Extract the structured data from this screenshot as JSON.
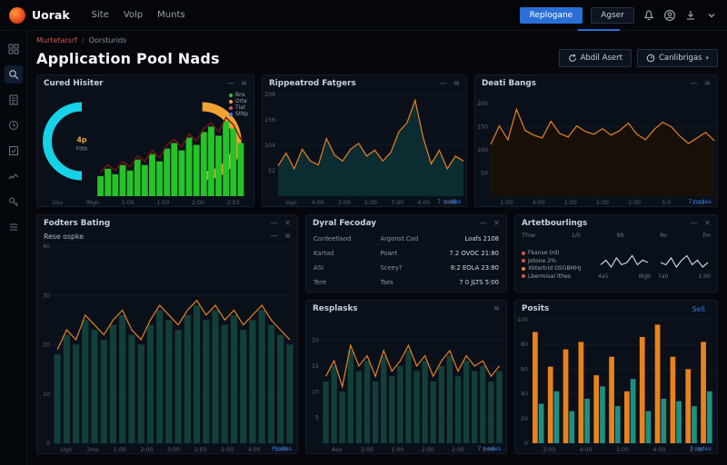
{
  "navbar": {
    "brand": "Uorak",
    "menu": [
      "Site",
      "Volp",
      "Munts"
    ],
    "primary_button": "Replogane",
    "secondary_button": "Agser"
  },
  "icons": {
    "minimize": "—",
    "menu": "≡",
    "close": "×",
    "chevron": "▾"
  },
  "breadcrumb": {
    "first": "Murtetarsrf",
    "separator": "/",
    "second": "Oorsturids"
  },
  "page": {
    "title": "Application Pool Nads",
    "action1": "Abdil Asert",
    "action2": "Canlibrigas"
  },
  "panels": {
    "health": {
      "title": "Cured Hisiter"
    },
    "requests": {
      "title": "Rippeatrod Fatgers",
      "footer": "7 nodbs"
    },
    "bangs": {
      "title": "Deati Bangs",
      "footer": "7 nodes"
    },
    "rating": {
      "title": "Fodters Bating",
      "subtitle": "Rese ospke",
      "footer": "Prodes"
    },
    "recovery": {
      "title": "Dyral Fecoday",
      "rows": [
        [
          "Cordeetlaod",
          "Argonst Cod",
          "Loafs 2108"
        ],
        [
          "Kartad",
          "Powrt",
          "7.2 OVOC 21:80"
        ],
        [
          "ASI",
          "Sceey?",
          "8:2 EOLA 23:80"
        ],
        [
          "Tere",
          "Tses",
          "7 0 JLTS 5:00"
        ]
      ]
    },
    "resplasks": {
      "title": "Resplasks",
      "footer": "7 nodes"
    },
    "bindings": {
      "title": "Artetbourlings",
      "columns": [
        "Tfow",
        "1/0",
        "99",
        "Ro",
        "fm"
      ],
      "legend": [
        {
          "label": "Fkanse (rd)",
          "color": "#d9534f"
        },
        {
          "label": "Jotone 2%",
          "color": "#d9534f"
        },
        {
          "label": "Xbtertrid OSGBMHJ",
          "color": "#e0873c"
        },
        {
          "label": "Lbermival lthes",
          "color": "#d9534f"
        }
      ],
      "spark1_labels": [
        "4a5",
        "Wgb"
      ],
      "spark2_labels": [
        "7a0",
        "1:00"
      ]
    },
    "posits": {
      "title": "Posits",
      "link": "Seit",
      "footer": "7 rodes"
    }
  },
  "chart_data": [
    {
      "id": "health",
      "type": "health",
      "title": "Cured Hisiter",
      "legend": [
        {
          "label": "Bns",
          "color": "#2fc42c"
        },
        {
          "label": "Orte",
          "color": "#f2a23a"
        },
        {
          "label": "Tlat",
          "color": "#d94f4f"
        },
        {
          "label": "StNp",
          "color": "#3b82e8"
        }
      ],
      "gauge": {
        "left_color": "#16d2e6",
        "right_color": "#f0a233"
      },
      "center_value": "4p",
      "center_label": "Fdlb",
      "bars": {
        "color": "#25c228",
        "values": [
          22,
          30,
          24,
          34,
          28,
          40,
          34,
          46,
          38,
          52,
          58,
          50,
          64,
          56,
          70,
          76,
          66,
          82,
          74,
          58
        ]
      },
      "line": {
        "stroke": "#7e1414",
        "values": [
          26,
          34,
          28,
          38,
          32,
          44,
          38,
          50,
          42,
          56,
          62,
          54,
          68,
          60,
          74,
          80,
          70,
          86,
          78,
          62
        ]
      },
      "xlabels": [
        "Uso",
        "Wgo",
        "1:00",
        "1:50",
        "2:00",
        "2:b3"
      ],
      "ymax": 100
    },
    {
      "id": "requests",
      "type": "area",
      "title": "Rippeatrod Fatgers",
      "yticks": [
        "208",
        "156",
        "104",
        "52"
      ],
      "ymax": 208,
      "line": {
        "stroke": "#e8821e",
        "fill": "#0b2d31",
        "values": [
          62,
          88,
          56,
          96,
          72,
          64,
          118,
          84,
          72,
          96,
          108,
          82,
          94,
          72,
          90,
          132,
          150,
          196,
          120,
          66,
          94,
          56,
          82,
          72
        ]
      },
      "xlabels": [
        "Ugo",
        "4:00",
        "2:00",
        "5:00",
        "7:00",
        "4:00",
        "2:00"
      ]
    },
    {
      "id": "bangs",
      "type": "area",
      "title": "Deati Bangs",
      "yticks": [
        "200",
        "150",
        "100",
        "50"
      ],
      "ymax": 220,
      "line": {
        "stroke": "#e8821e",
        "fill": "#181008",
        "values": [
          112,
          152,
          122,
          188,
          142,
          132,
          126,
          162,
          136,
          128,
          152,
          140,
          134,
          146,
          132,
          142,
          158,
          134,
          122,
          144,
          160,
          150,
          130,
          114,
          126,
          138,
          120
        ]
      },
      "xlabels": [
        "1:00",
        "4:00",
        "1:00",
        "5:00",
        "2:00",
        "5:0",
        "1:00"
      ]
    },
    {
      "id": "rating",
      "type": "barsline",
      "title": "Rese ospke",
      "yticks": [
        "40",
        "30",
        "20",
        "10",
        "0"
      ],
      "ymax": 40,
      "bars": {
        "color": "#123f39",
        "values": [
          18,
          22,
          20,
          25,
          23,
          21,
          24,
          26,
          22,
          20,
          24,
          27,
          25,
          23,
          26,
          28,
          25,
          27,
          24,
          26,
          23,
          25,
          27,
          24,
          22,
          20
        ]
      },
      "line": {
        "stroke": "#e8821e",
        "values": [
          19,
          23,
          21,
          26,
          24,
          22,
          25,
          27,
          23,
          21,
          25,
          28,
          26,
          24,
          27,
          29,
          26,
          28,
          25,
          27,
          24,
          26,
          28,
          25,
          23,
          21
        ]
      },
      "xlabels": [
        "Ugo",
        "2ms",
        "1:00",
        "2:00",
        "3:00",
        "2:03",
        "2:00",
        "4:00",
        "2:00"
      ]
    },
    {
      "id": "resplasks",
      "type": "barsline",
      "title": "Resplasks",
      "yticks": [
        "20",
        "15",
        "10",
        "5"
      ],
      "ymax": 24,
      "bars": {
        "color": "#123f39",
        "values": [
          12,
          15,
          10,
          18,
          14,
          16,
          12,
          17,
          13,
          15,
          18,
          14,
          16,
          12,
          15,
          17,
          13,
          16,
          14,
          15,
          12,
          14
        ]
      },
      "line": {
        "stroke": "#e8821e",
        "values": [
          13,
          16,
          11,
          19,
          15,
          17,
          13,
          18,
          14,
          16,
          19,
          15,
          17,
          13,
          16,
          18,
          14,
          17,
          15,
          16,
          13,
          15
        ]
      },
      "xlabels": [
        "Aso",
        "2:00",
        "1:00",
        "2:00",
        "2:00",
        "2:00"
      ]
    },
    {
      "id": "spark1",
      "type": "line",
      "title": "bindings-sparkline-1",
      "line": {
        "stroke": "#c9d1d9",
        "values": [
          3,
          5,
          2,
          6,
          3,
          4,
          7,
          3,
          5,
          4
        ]
      },
      "ymax": 8
    },
    {
      "id": "spark2",
      "type": "line",
      "title": "bindings-sparkline-2",
      "line": {
        "stroke": "#c9d1d9",
        "values": [
          4,
          3,
          6,
          2,
          5,
          7,
          3,
          5,
          2,
          4
        ]
      },
      "ymax": 8
    },
    {
      "id": "posits",
      "type": "groupbars",
      "title": "Posits",
      "yticks": [
        "100",
        "80",
        "60",
        "40",
        "20",
        "0"
      ],
      "ymax": 100,
      "series": [
        {
          "color": "#e8821e",
          "values": [
            90,
            62,
            76,
            82,
            55,
            70,
            42,
            86,
            96,
            70,
            60,
            82
          ]
        },
        {
          "color": "#1f8f84",
          "values": [
            32,
            42,
            26,
            36,
            46,
            30,
            52,
            26,
            36,
            34,
            30,
            42
          ]
        }
      ],
      "xlabels": [
        "2:00",
        "4:00",
        "1:00",
        "4:00",
        "2:b8"
      ]
    }
  ]
}
